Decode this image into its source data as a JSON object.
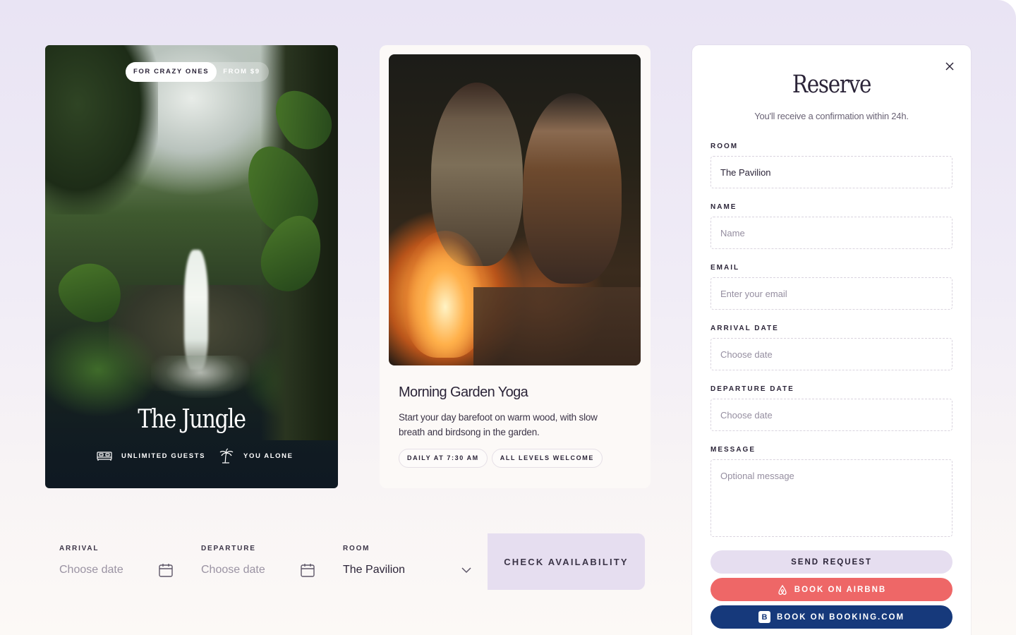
{
  "jungle_card": {
    "badge_primary": "FOR CRAZY ONES",
    "badge_secondary": "FROM $9",
    "title": "The Jungle",
    "guests_icon": "bed-icon",
    "guests_label": "UNLIMITED GUESTS",
    "solo_icon": "palm-tree-icon",
    "solo_label": "YOU ALONE"
  },
  "yoga_card": {
    "title": "Morning Garden Yoga",
    "description": "Start your day barefoot on warm wood, with slow breath and birdsong in the garden.",
    "tags": [
      "DAILY AT 7:30 AM",
      "ALL LEVELS WELCOME"
    ]
  },
  "availability": {
    "arrival_label": "ARRIVAL",
    "arrival_placeholder": "Choose date",
    "departure_label": "DEPARTURE",
    "departure_placeholder": "Choose date",
    "room_label": "ROOM",
    "room_value": "The Pavilion",
    "check_button": "CHECK AVAILABILITY"
  },
  "reserve": {
    "title": "Reserve",
    "subtitle": "You'll receive a confirmation within 24h.",
    "room_label": "ROOM",
    "room_value": "The Pavilion",
    "name_label": "NAME",
    "name_placeholder": "Name",
    "email_label": "EMAIL",
    "email_placeholder": "Enter your email",
    "arrival_label": "ARRIVAL DATE",
    "arrival_placeholder": "Choose date",
    "departure_label": "DEPARTURE DATE",
    "departure_placeholder": "Choose date",
    "message_label": "MESSAGE",
    "message_placeholder": "Optional message",
    "send_button": "SEND REQUEST",
    "airbnb_button": "BOOK ON AIRBNB",
    "booking_button": "BOOK ON BOOKING.COM",
    "booking_logo_letter": "B"
  },
  "colors": {
    "accent_lavender": "#e6def0",
    "airbnb_red": "#ee6767",
    "booking_blue": "#16397b",
    "text_dark": "#2b2438"
  }
}
